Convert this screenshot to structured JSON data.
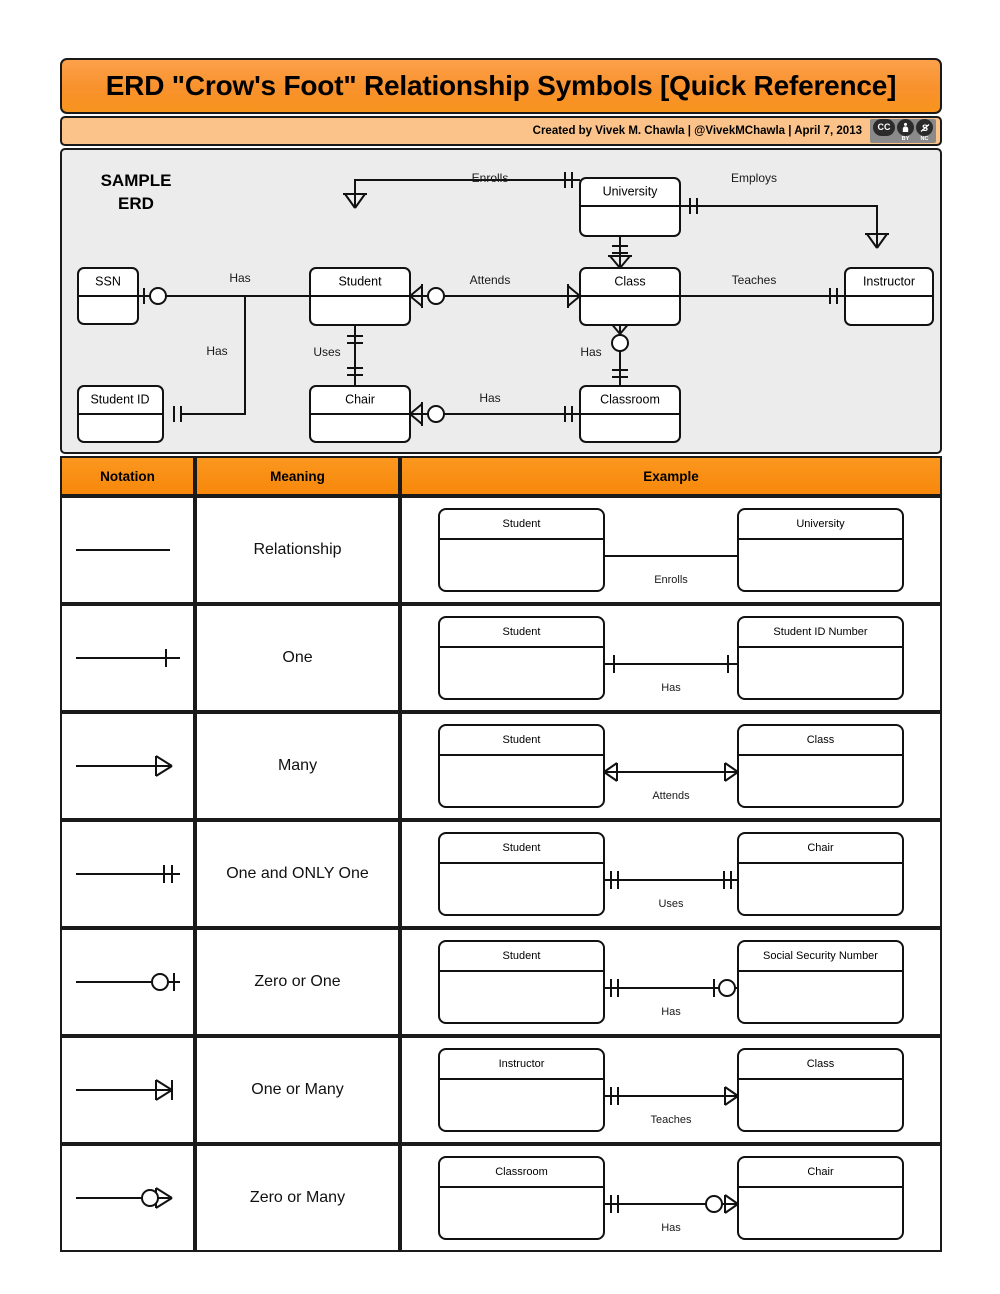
{
  "page": {
    "title": "ERD \"Crow's Foot\" Relationship Symbols [Quick Reference]",
    "credit": "Created by Vivek M. Chawla  |  @VivekMChawla  |  April 7, 2013",
    "license": {
      "badge": "cc-by-nc-badge",
      "cc_mark": "CC",
      "by_mark": "BY",
      "nc_mark": "NC",
      "by_glyph": "ⓘ",
      "nc_glyph": "ⓢ"
    },
    "colors": {
      "title_orange": "#F7941E",
      "credit_orange": "#FBC289",
      "header_orange": "#F7880B",
      "meaning_orange_top": "#FCC894",
      "meaning_orange_bottom": "#F9AE68",
      "panel_gray": "#ECECEC",
      "outline": "#111111",
      "page_background": "#FFFFFF"
    }
  },
  "sample_erd": {
    "heading_line1": "SAMPLE",
    "heading_line2": "ERD",
    "entities": [
      {
        "name": "SSN"
      },
      {
        "name": "Student ID"
      },
      {
        "name": "Student"
      },
      {
        "name": "Chair"
      },
      {
        "name": "University"
      },
      {
        "name": "Class"
      },
      {
        "name": "Classroom"
      },
      {
        "name": "Instructor"
      }
    ],
    "relationships": [
      {
        "label": "Enrolls",
        "from": "Student",
        "to": "University"
      },
      {
        "label": "Employs",
        "from": "University",
        "to": "Instructor"
      },
      {
        "label": "Has",
        "from": "SSN",
        "to": "Student"
      },
      {
        "label": "Has",
        "from": "Student ID",
        "to": "Student"
      },
      {
        "label": "Attends",
        "from": "Student",
        "to": "Class"
      },
      {
        "label": "Teaches",
        "from": "Class",
        "to": "Instructor"
      },
      {
        "label": "Uses",
        "from": "Student",
        "to": "Chair"
      },
      {
        "label": "Has",
        "from": "Chair",
        "to": "Classroom"
      },
      {
        "label": "Has",
        "from": "Class",
        "to": "Classroom"
      }
    ]
  },
  "table": {
    "headers": {
      "notation": "Notation",
      "meaning": "Meaning",
      "example": "Example"
    },
    "rows": [
      {
        "notation_symbol": "plain-line",
        "meaning": "Relationship",
        "example": {
          "left_entity": "Student",
          "right_entity": "University",
          "label": "Enrolls",
          "left_marker": "none",
          "right_marker": "none"
        }
      },
      {
        "notation_symbol": "one-tick",
        "meaning": "One",
        "example": {
          "left_entity": "Student",
          "right_entity": "Student ID Number",
          "label": "Has",
          "left_marker": "one",
          "right_marker": "one"
        }
      },
      {
        "notation_symbol": "crows-foot",
        "meaning": "Many",
        "example": {
          "left_entity": "Student",
          "right_entity": "Class",
          "label": "Attends",
          "left_marker": "many",
          "right_marker": "many"
        }
      },
      {
        "notation_symbol": "double-tick",
        "meaning": "One and ONLY One",
        "example": {
          "left_entity": "Student",
          "right_entity": "Chair",
          "label": "Uses",
          "left_marker": "one-only-one",
          "right_marker": "one-only-one"
        }
      },
      {
        "notation_symbol": "circle-tick",
        "meaning": "Zero or One",
        "example": {
          "left_entity": "Student",
          "right_entity": "Social Security Number",
          "label": "Has",
          "left_marker": "one-only-one",
          "right_marker": "zero-or-one"
        }
      },
      {
        "notation_symbol": "tick-crows-foot",
        "meaning": "One or Many",
        "example": {
          "left_entity": "Instructor",
          "right_entity": "Class",
          "label": "Teaches",
          "left_marker": "one-only-one",
          "right_marker": "one-or-many"
        }
      },
      {
        "notation_symbol": "circle-crows-foot",
        "meaning": "Zero or Many",
        "example": {
          "left_entity": "Classroom",
          "right_entity": "Chair",
          "label": "Has",
          "left_marker": "one-only-one",
          "right_marker": "zero-or-many"
        }
      }
    ]
  }
}
